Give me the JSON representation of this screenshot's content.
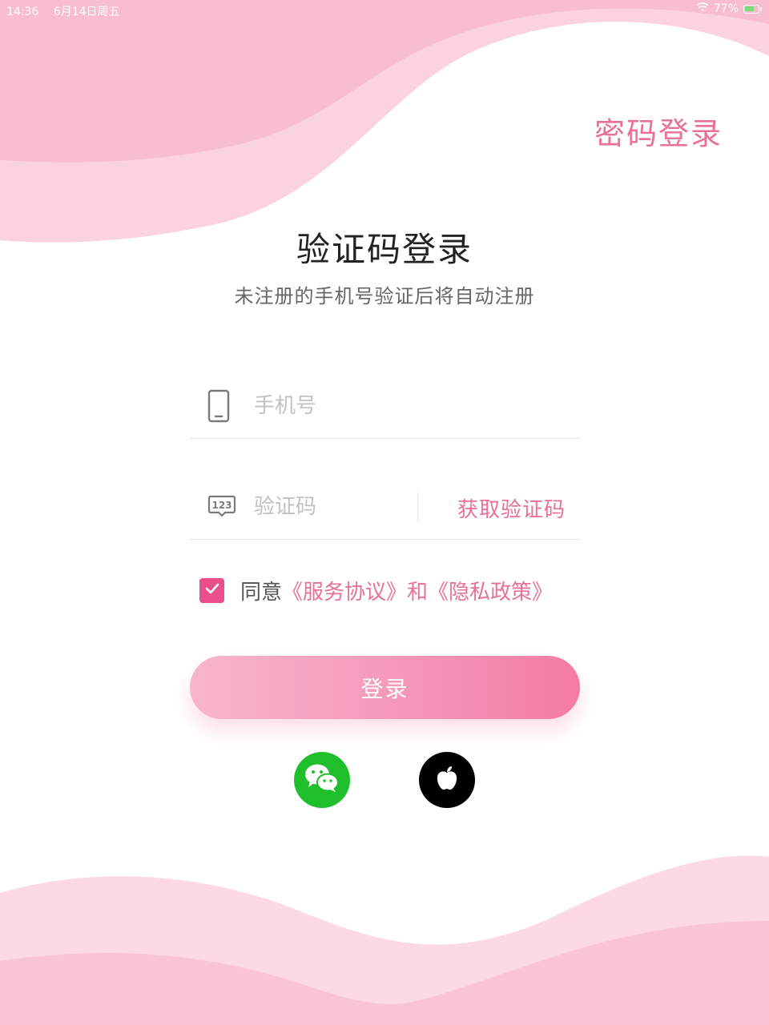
{
  "status_bar": {
    "time": "14:36",
    "date": "6月14日周五",
    "battery_percent_text": "77%",
    "battery_level": 0.77,
    "wifi_icon": "wifi-icon"
  },
  "header": {
    "password_login": "密码登录"
  },
  "main": {
    "title": "验证码登录",
    "subtitle": "未注册的手机号验证后将自动注册"
  },
  "form": {
    "phone": {
      "placeholder": "手机号",
      "value": "",
      "icon": "phone-icon"
    },
    "code": {
      "placeholder": "验证码",
      "value": "",
      "icon": "keypad-123-icon",
      "get_code_label": "获取验证码"
    },
    "agreement": {
      "checked": true,
      "prefix": "同意",
      "service_link": "《服务协议》",
      "and": "和",
      "privacy_link": "《隐私政策》"
    },
    "login_label": "登录"
  },
  "social": {
    "wechat_icon": "wechat-icon",
    "apple_icon": "apple-icon"
  },
  "colors": {
    "accent": "#e8709b",
    "checkbox": "#ea4f8b",
    "wechat": "#1fbf2c",
    "apple": "#000000"
  }
}
